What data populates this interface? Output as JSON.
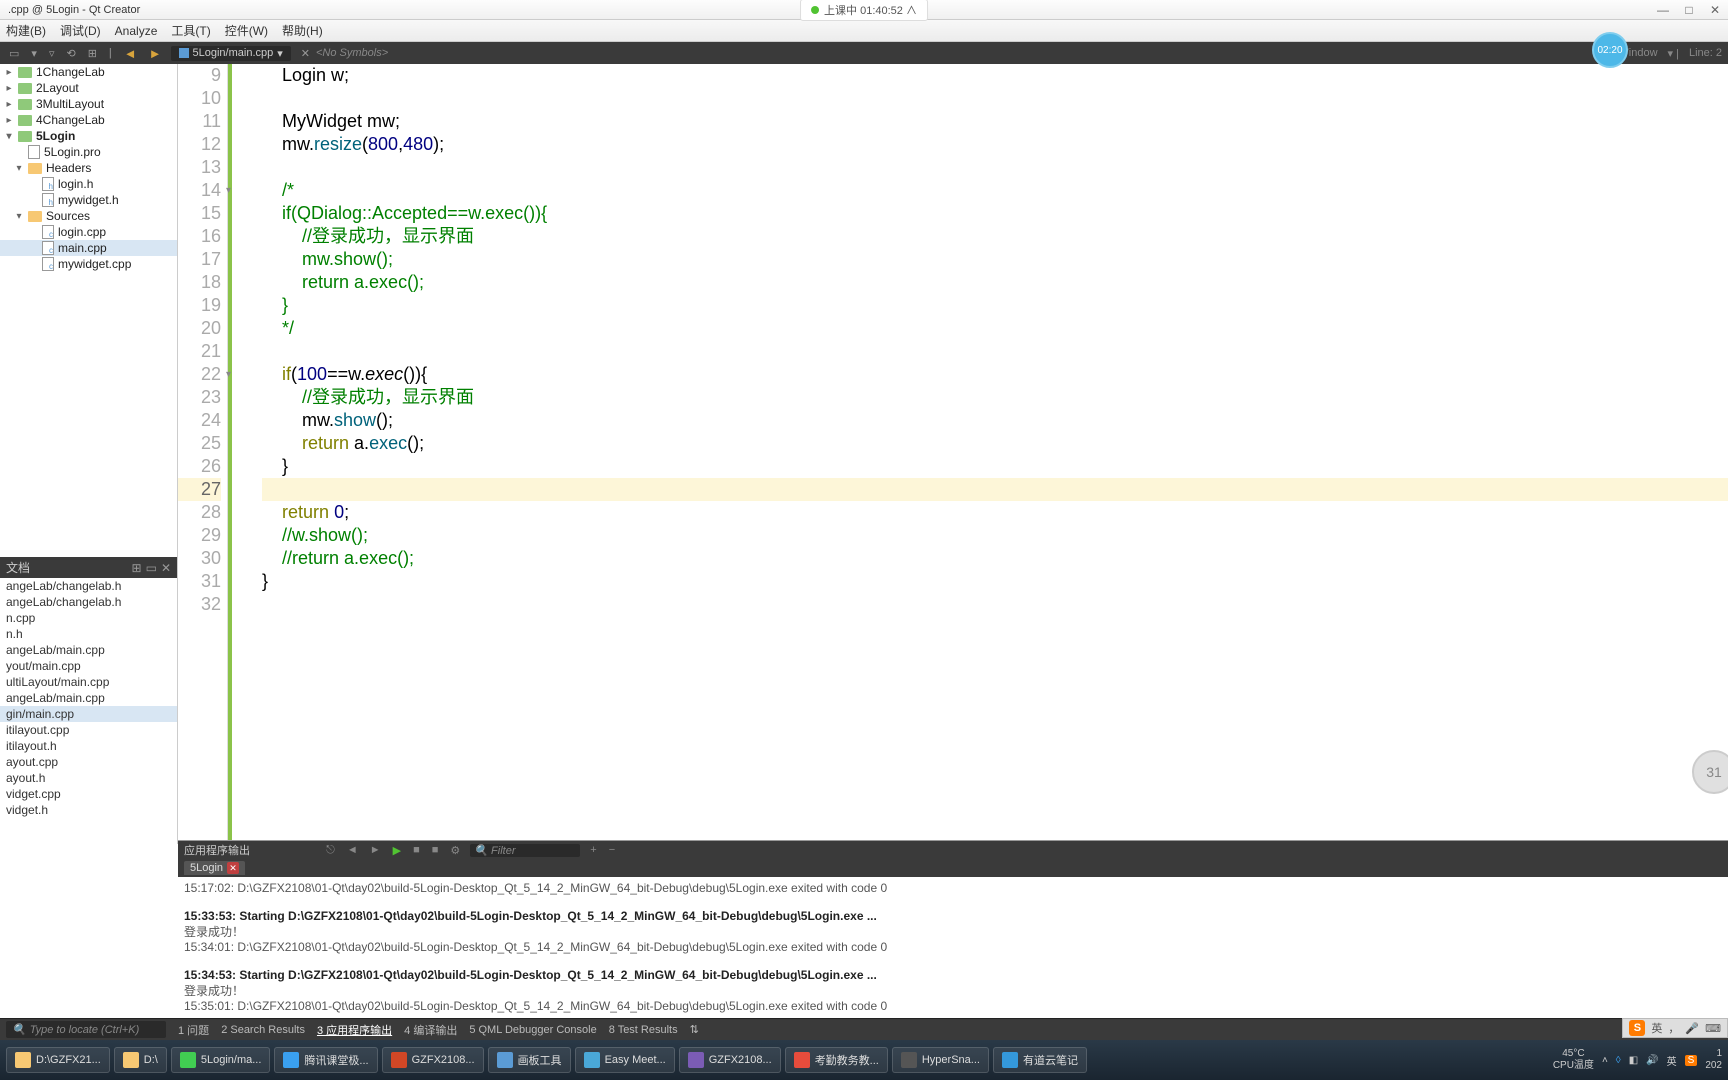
{
  "window": {
    "title": ".cpp @ 5Login - Qt Creator",
    "center_badge": "上课中 01:40:52 ∧"
  },
  "menus": [
    "构建(B)",
    "调试(D)",
    "Analyze",
    "工具(T)",
    "控件(W)",
    "帮助(H)"
  ],
  "toolbar": {
    "file_tab": "5Login/main.cpp",
    "no_symbols": "<No Symbols>",
    "encoding": "Window",
    "line_label": "Line: 2"
  },
  "timer_badge": "02:20",
  "circle_badge": "31",
  "project_tree": [
    {
      "label": "1ChangeLab",
      "icon": "folder-green",
      "indent": 0,
      "expand": ">"
    },
    {
      "label": "2Layout",
      "icon": "folder-green",
      "indent": 0,
      "expand": ">"
    },
    {
      "label": "3MultiLayout",
      "icon": "folder-green",
      "indent": 0,
      "expand": ">"
    },
    {
      "label": "4ChangeLab",
      "icon": "folder-green",
      "indent": 0,
      "expand": ">"
    },
    {
      "label": "5Login",
      "icon": "folder-green",
      "indent": 0,
      "expand": "v",
      "bold": true
    },
    {
      "label": "5Login.pro",
      "icon": "pro",
      "indent": 1
    },
    {
      "label": "Headers",
      "icon": "folder",
      "indent": 1,
      "expand": "v"
    },
    {
      "label": "login.h",
      "icon": "h",
      "indent": 2
    },
    {
      "label": "mywidget.h",
      "icon": "h",
      "indent": 2
    },
    {
      "label": "Sources",
      "icon": "folder",
      "indent": 1,
      "expand": "v"
    },
    {
      "label": "login.cpp",
      "icon": "cpp",
      "indent": 2
    },
    {
      "label": "main.cpp",
      "icon": "cpp",
      "indent": 2,
      "selected": true
    },
    {
      "label": "mywidget.cpp",
      "icon": "cpp",
      "indent": 2
    }
  ],
  "open_docs": {
    "header": "文档",
    "items": [
      "angeLab/changelab.h",
      "angeLab/changelab.h",
      "n.cpp",
      "n.h",
      "angeLab/main.cpp",
      "yout/main.cpp",
      "ultiLayout/main.cpp",
      "angeLab/main.cpp",
      "gin/main.cpp",
      "itilayout.cpp",
      "itilayout.h",
      "ayout.cpp",
      "ayout.h",
      "vidget.cpp",
      "vidget.h"
    ],
    "selected_index": 8
  },
  "code_lines": [
    {
      "n": 9,
      "html": "    Login w;"
    },
    {
      "n": 10,
      "html": ""
    },
    {
      "n": 11,
      "html": "    MyWidget mw;"
    },
    {
      "n": 12,
      "html": "    mw.<span class='fn'>resize</span>(<span class='num'>800</span>,<span class='num'>480</span>);"
    },
    {
      "n": 13,
      "html": ""
    },
    {
      "n": 14,
      "html": "    <span class='comment'>/*</span>",
      "fold": true
    },
    {
      "n": 15,
      "html": "<span class='comment'>    if(QDialog::Accepted==w.exec()){</span>"
    },
    {
      "n": 16,
      "html": "<span class='comment'>        //登录成功，显示界面</span>"
    },
    {
      "n": 17,
      "html": "<span class='comment'>        mw.show();</span>"
    },
    {
      "n": 18,
      "html": "<span class='comment'>        return a.exec();</span>"
    },
    {
      "n": 19,
      "html": "<span class='comment'>    }</span>"
    },
    {
      "n": 20,
      "html": "<span class='comment'>    */</span>"
    },
    {
      "n": 21,
      "html": ""
    },
    {
      "n": 22,
      "html": "    <span class='kw'>if</span>(<span class='num'>100</span>==w.<span class='fn-italic'>exec</span>()){",
      "fold": true
    },
    {
      "n": 23,
      "html": "        <span class='comment'>//登录成功，显示界面</span>"
    },
    {
      "n": 24,
      "html": "        mw.<span class='fn'>show</span>();"
    },
    {
      "n": 25,
      "html": "        <span class='kw'>return</span> a.<span class='fn'>exec</span>();"
    },
    {
      "n": 26,
      "html": "    }"
    },
    {
      "n": 27,
      "html": "",
      "current": true
    },
    {
      "n": 28,
      "html": "    <span class='kw'>return</span> <span class='num'>0</span>;"
    },
    {
      "n": 29,
      "html": "    <span class='comment'>//w.show();</span>"
    },
    {
      "n": 30,
      "html": "    <span class='comment'>//return a.exec();</span>"
    },
    {
      "n": 31,
      "html": "}"
    },
    {
      "n": 32,
      "html": ""
    }
  ],
  "output": {
    "header_title": "应用程序输出",
    "filter_placeholder": "Filter",
    "tab": "5Login",
    "lines": [
      {
        "t": "15:17:02: D:\\GZFX2108\\01-Qt\\day02\\build-5Login-Desktop_Qt_5_14_2_MinGW_64_bit-Debug\\debug\\5Login.exe exited with code 0"
      },
      {
        "t": ""
      },
      {
        "t": "15:33:53: Starting D:\\GZFX2108\\01-Qt\\day02\\build-5Login-Desktop_Qt_5_14_2_MinGW_64_bit-Debug\\debug\\5Login.exe ...",
        "bold": true
      },
      {
        "t": "登录成功！"
      },
      {
        "t": "15:34:01: D:\\GZFX2108\\01-Qt\\day02\\build-5Login-Desktop_Qt_5_14_2_MinGW_64_bit-Debug\\debug\\5Login.exe exited with code 0"
      },
      {
        "t": ""
      },
      {
        "t": "15:34:53: Starting D:\\GZFX2108\\01-Qt\\day02\\build-5Login-Desktop_Qt_5_14_2_MinGW_64_bit-Debug\\debug\\5Login.exe ...",
        "bold": true
      },
      {
        "t": "登录成功！"
      },
      {
        "t": "15:35:01: D:\\GZFX2108\\01-Qt\\day02\\build-5Login-Desktop_Qt_5_14_2_MinGW_64_bit-Debug\\debug\\5Login.exe exited with code 0"
      }
    ]
  },
  "locator": {
    "placeholder": "Type to locate (Ctrl+K)",
    "items": [
      {
        "label": "1 问题"
      },
      {
        "label": "2 Search Results"
      },
      {
        "label": "3 应用程序输出",
        "active": true
      },
      {
        "label": "4 编译输出"
      },
      {
        "label": "5 QML Debugger Console"
      },
      {
        "label": "8 Test Results"
      }
    ]
  },
  "taskbar": {
    "items": [
      {
        "label": "D:\\GZFX21...",
        "icon": "ti-folder"
      },
      {
        "label": "D:\\",
        "icon": "ti-folder"
      },
      {
        "label": "5Login/ma...",
        "icon": "ti-qt"
      },
      {
        "label": "腾讯课堂极...",
        "icon": "ti-tencent"
      },
      {
        "label": "GZFX2108...",
        "icon": "ti-ppt1"
      },
      {
        "label": "画板工具",
        "icon": "ti-paint"
      },
      {
        "label": "Easy Meet...",
        "icon": "ti-easy"
      },
      {
        "label": "GZFX2108...",
        "icon": "ti-purple"
      },
      {
        "label": "考勤教务教...",
        "icon": "ti-kt"
      },
      {
        "label": "HyperSna...",
        "icon": "ti-hyper"
      },
      {
        "label": "有道云笔记",
        "icon": "ti-note"
      }
    ],
    "temp": {
      "l1": "45°C",
      "l2": "CPU温度"
    },
    "clock": {
      "l1": "1",
      "l2": "202"
    },
    "ime": "英 , ● s"
  },
  "ime_badge": {
    "s": "S",
    "text": "英"
  }
}
